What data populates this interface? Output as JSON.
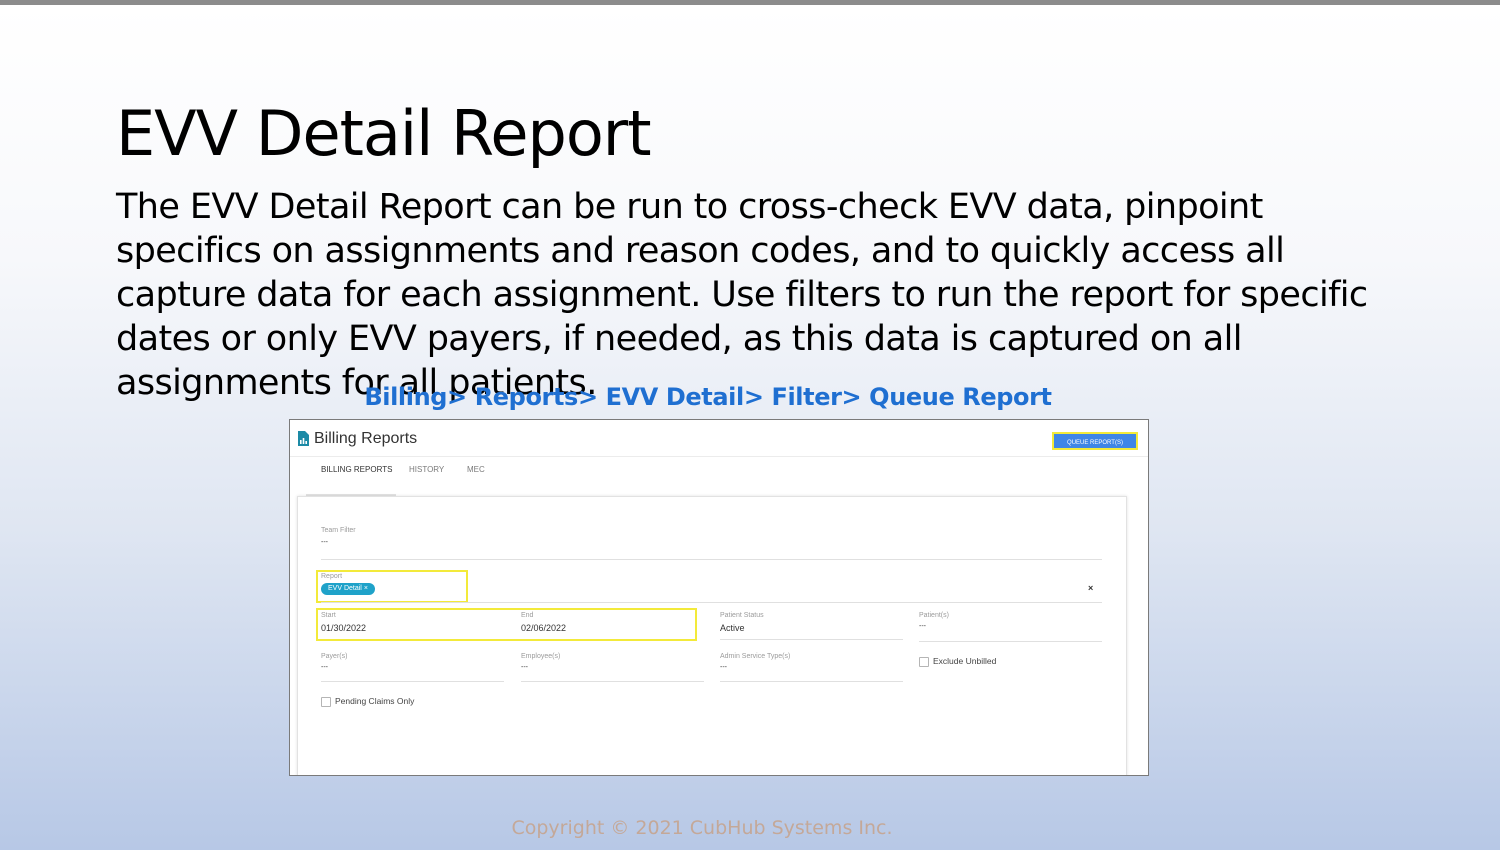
{
  "slide": {
    "title": "EVV Detail Report",
    "body": "The EVV Detail Report can be run to cross-check EVV data, pinpoint specifics on assignments and reason codes, and to quickly access all capture data for each assignment. Use filters to run the report for specific dates or only EVV payers, if needed, as this data is captured on all assignments for all patients.",
    "breadcrumb": "Billing> Reports> EVV Detail> Filter> Queue Report",
    "copyright": "Copyright © 2021 CubHub Systems Inc."
  },
  "app": {
    "title": "Billing Reports",
    "queue_button": "QUEUE REPORT(S)",
    "tabs": [
      "BILLING REPORTS",
      "HISTORY",
      "MEC"
    ],
    "active_tab": "BILLING REPORTS"
  },
  "filters": {
    "team_filter": {
      "label": "Team Filter",
      "value": "---"
    },
    "report": {
      "label": "Report",
      "chip": "EVV Detail",
      "clear": "×"
    },
    "start": {
      "label": "Start",
      "value": "01/30/2022"
    },
    "end": {
      "label": "End",
      "value": "02/06/2022"
    },
    "patient_status": {
      "label": "Patient Status",
      "value": "Active"
    },
    "patients": {
      "label": "Patient(s)",
      "value": "---"
    },
    "payers": {
      "label": "Payer(s)",
      "value": "---"
    },
    "employees": {
      "label": "Employee(s)",
      "value": "---"
    },
    "admin_service_types": {
      "label": "Admin Service Type(s)",
      "value": "---"
    },
    "exclude_unbilled": {
      "label": "Exclude Unbilled",
      "checked": false
    },
    "pending_claims_only": {
      "label": "Pending Claims Only",
      "checked": false
    }
  },
  "colors": {
    "breadcrumb": "#1f6fd1",
    "highlight": "#f3ea3a",
    "primary_button": "#3f86e6",
    "chip": "#1fa2c9"
  }
}
